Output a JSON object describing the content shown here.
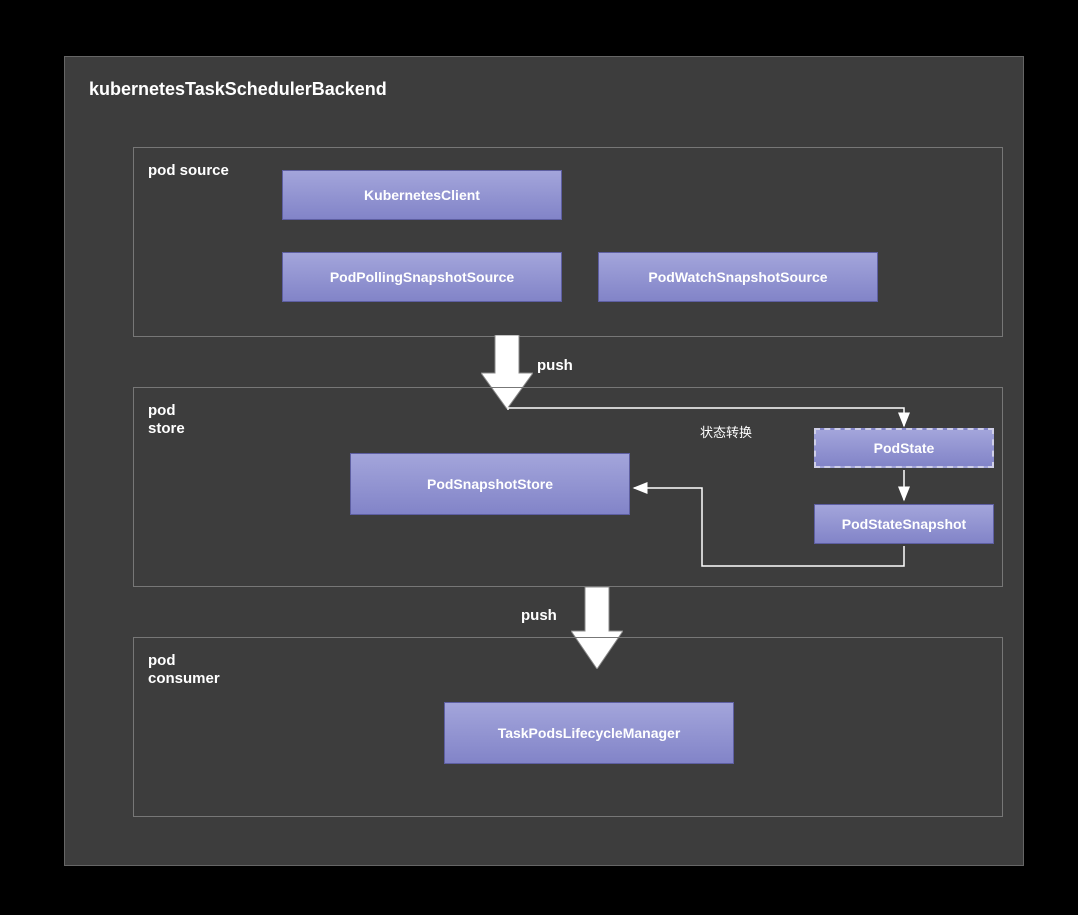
{
  "title": "kubernetesTaskSchedulerBackend",
  "sections": {
    "source": {
      "title": "pod source"
    },
    "store": {
      "title": "pod\nstore"
    },
    "consumer": {
      "title": "pod\nconsumer"
    }
  },
  "nodes": {
    "kubernetesClient": "KubernetesClient",
    "podPollingSnapshotSource": "PodPollingSnapshotSource",
    "podWatchSnapshotSource": "PodWatchSnapshotSource",
    "podSnapshotStore": "PodSnapshotStore",
    "podState": "PodState",
    "podStateSnapshot": "PodStateSnapshot",
    "taskPodsLifecycleManager": "TaskPodsLifecycleManager"
  },
  "labels": {
    "push1": "push",
    "push2": "push",
    "stateTransition": "状态转换"
  },
  "colors": {
    "bg": "#000000",
    "panel": "#3d3d3d",
    "nodeTop": "#a3a5db",
    "nodeBottom": "#8284c8",
    "border": "#666666",
    "arrowFill": "#ffffff"
  }
}
